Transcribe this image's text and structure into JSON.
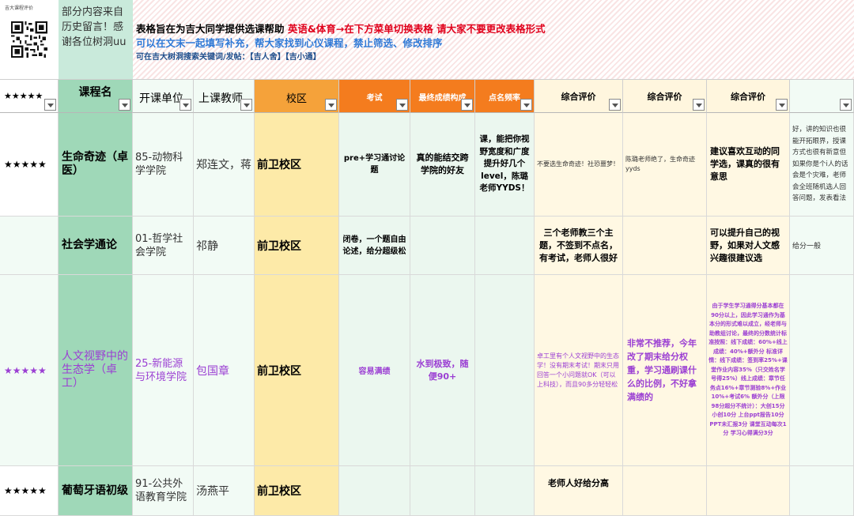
{
  "banner": {
    "qr_caption": "吉大课程评价",
    "note": "部分内容来自历史留言！感谢各位树洞uu",
    "line1_black": "表格旨在为吉大同学提供选课帮助",
    "line1_red": "英语&体育→在下方菜单切换表格  请大家不要更改表格形式",
    "line2": "可以在文末一起填写补充，帮大家找到心仪课程，禁止筛选、修改排序",
    "line3": "可在吉大树洞搜索关键词/发帖：【吉人舍】【吉小通】"
  },
  "headers": [
    {
      "label": "★★★★★",
      "bg": "#ffffff"
    },
    {
      "label": "课程名",
      "bg": "#9fd8b8"
    },
    {
      "label": "开课单位",
      "bg": "#f2fbf5"
    },
    {
      "label": "上课教师",
      "bg": "#f2fbf5"
    },
    {
      "label": "校区",
      "bg": "#f5a23a"
    },
    {
      "label": "考试",
      "bg": "#f47c1e"
    },
    {
      "label": "最终成绩构成",
      "bg": "#f47c1e"
    },
    {
      "label": "点名频率",
      "bg": "#f47c1e"
    },
    {
      "label": "综合评价",
      "bg": "#fff6de"
    },
    {
      "label": "综合评价",
      "bg": "#fff6de"
    },
    {
      "label": "综合评价",
      "bg": "#fff6de"
    },
    {
      "label": "",
      "bg": "#f2fbf5"
    }
  ],
  "rows": [
    {
      "stars": "★★★★★",
      "course": "生命奇迹（卓医）",
      "unit": "85-动物科学学院",
      "teacher": "郑连文，蒋",
      "campus": "前卫校区",
      "exam": "pre+学习通讨论题",
      "grade": "真的能结交跨学院的好友",
      "rollcall": "课，能把你视野宽度和广度提升好几个level，陈璐老师YYDS！",
      "review1": "不要选生命奇迹！社恐噩梦！",
      "review2": "陈璐老师绝了，生命奇迹yyds",
      "review3": "建议喜欢互动的同学选，课真的很有意思",
      "extra": "好，讲的知识也很能开拓眼界，授课方式也很有新意但如果你是个i人的话会是个灾难，老师会全班随机选人回答问题，发表看法"
    },
    {
      "stars": "",
      "course": "社会学通论",
      "unit": "01-哲学社会学院",
      "teacher": "祁静",
      "campus": "前卫校区",
      "exam": "闭卷，一个题自由论述，给分超级松",
      "grade": "",
      "rollcall": "",
      "review1": "三个老师教三个主题，不签到不点名，有考试，老师人很好",
      "review2": "",
      "review3": "可以提升自己的视野，如果对人文感兴趣很建议选",
      "extra": "给分一般"
    },
    {
      "stars": "★★★★★",
      "course": "人文视野中的生态学（卓工）",
      "unit": "25-新能源与环境学院",
      "teacher": "包国章",
      "campus": "前卫校区",
      "exam": "容易满绩",
      "grade": "水到极致，随便90+",
      "rollcall": "",
      "review1": "卓工里有个人文视野中的生态学！没有期末考试！期末只用回答一个小问题就OK（可以上科技），而且90多分轻轻松",
      "review2": "非常不推荐，今年改了期末给分权重，学习通刷课什么的比例，不好拿满绩的",
      "review3": "由于学生学习通得分基本都在90分以上，因此学习通作为基本分的形式难以成立，经老师与助教组讨论，最终的分数统计标准按照：线下成绩：60%+线上成绩：40%+额外分 标准详情：线下成绩：签到率25%+课堂作业内容35%（只交姓名学号得25%）线上成绩：章节任务点16%+章节测验8%+作业10%+考试6% 额外分（上限98分超分不统计）：大创15分 小创10分 上台ppt报告10分 PPT未汇报3分 课堂互动每次1分 学习心得满分3分",
      "extra": ""
    },
    {
      "stars": "★★★★★",
      "course": "葡萄牙语初级",
      "unit": "91-公共外语教育学院",
      "teacher": "汤燕平",
      "campus": "前卫校区",
      "exam": "",
      "grade": "",
      "rollcall": "",
      "review1": "老师人好给分高",
      "review2": "",
      "review3": "",
      "extra": ""
    }
  ],
  "colors": {
    "course_bg": "#9fd8b8",
    "campus_bg": "#fdeaa8",
    "red_text": "#e0001b",
    "blue_text": "#2f79d6",
    "purple_text": "#9b3fd3"
  }
}
